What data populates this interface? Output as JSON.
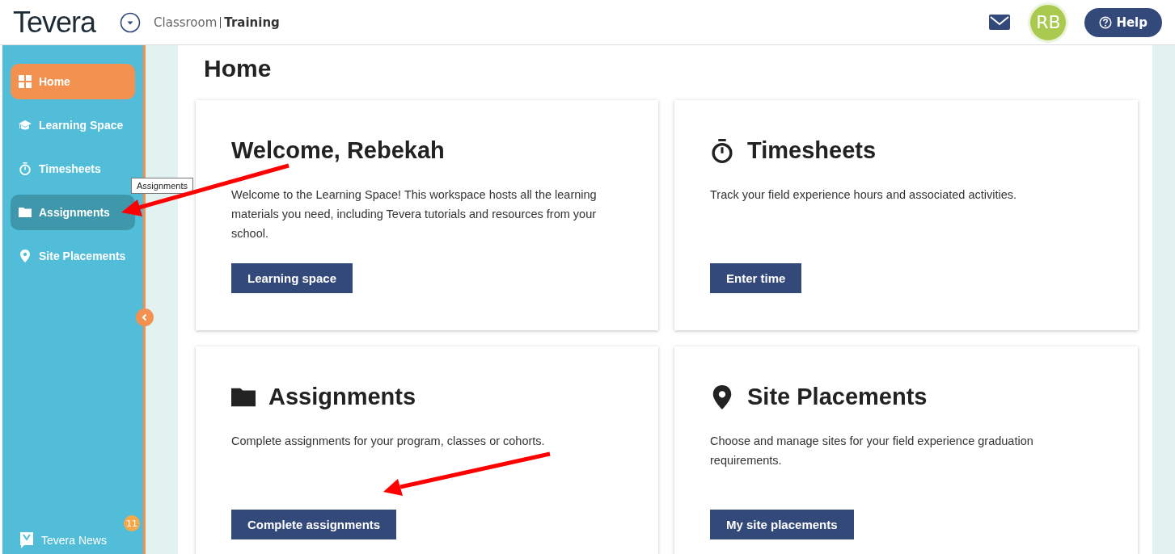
{
  "header": {
    "logo": "Tevera",
    "context": "Classroom",
    "context_name": "Training",
    "avatar": "RB",
    "help": "Help"
  },
  "sidebar": {
    "items": [
      {
        "label": "Home",
        "kind": "grid",
        "selected": true,
        "hovered": false
      },
      {
        "label": "Learning Space",
        "kind": "cap",
        "selected": false,
        "hovered": false
      },
      {
        "label": "Timesheets",
        "kind": "stopwatch",
        "selected": false,
        "hovered": false
      },
      {
        "label": "Assignments",
        "kind": "folder",
        "selected": false,
        "hovered": true
      },
      {
        "label": "Site Placements",
        "kind": "pin",
        "selected": false,
        "hovered": false
      }
    ],
    "tooltip": "Assignments",
    "news": {
      "label": "Tevera News",
      "count": "11"
    }
  },
  "page": {
    "title": "Home"
  },
  "cards": [
    {
      "kind": "none",
      "title": "Welcome, Rebekah",
      "text": "Welcome to the Learning Space! This workspace hosts all the learning materials you need, including Tevera tutorials and resources from your school.",
      "button": "Learning space"
    },
    {
      "kind": "stopwatch",
      "title": "Timesheets",
      "text": "Track your field experience hours and associated activities.",
      "button": "Enter time"
    },
    {
      "kind": "folder",
      "title": "Assignments",
      "text": "Complete assignments for your program, classes or cohorts.",
      "button": "Complete assignments"
    },
    {
      "kind": "pin",
      "title": "Site Placements",
      "text": "Choose and manage sites for your field experience graduation requirements.",
      "button": "My site placements"
    }
  ]
}
